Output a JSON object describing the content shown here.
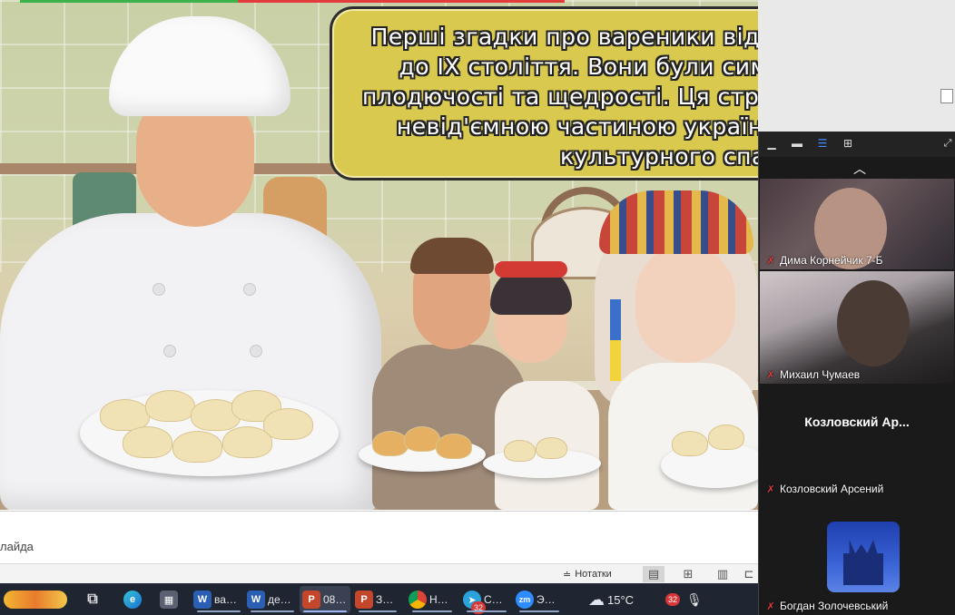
{
  "slide": {
    "speech_lines": [
      "Перші згадки про вареники відносяться",
      "до IX століття. Вони були символом",
      "плодючості та щедрості. Ця страва стала",
      "невід'ємною частиною українського",
      "культурного спадку."
    ]
  },
  "notes": {
    "hint_text": "лайда"
  },
  "statusbar": {
    "notes_label": "Нотатки"
  },
  "taskbar": {
    "items": [
      {
        "label": "ва…"
      },
      {
        "label": "де…"
      },
      {
        "label": "08…"
      },
      {
        "label": "З…"
      },
      {
        "label": "Н…"
      },
      {
        "label": "С…"
      },
      {
        "label": "Э…"
      }
    ],
    "weather": "15°C",
    "badge_telegram": "32",
    "badge_tray": "32"
  },
  "zoom": {
    "participants": [
      {
        "name": "Дима Корнейчик 7-Б"
      },
      {
        "name": "Михаил Чумаев"
      },
      {
        "name": "Козловский Арсений",
        "display_title": "Козловский Ар..."
      },
      {
        "name": "Богдан Золочевський"
      }
    ]
  }
}
